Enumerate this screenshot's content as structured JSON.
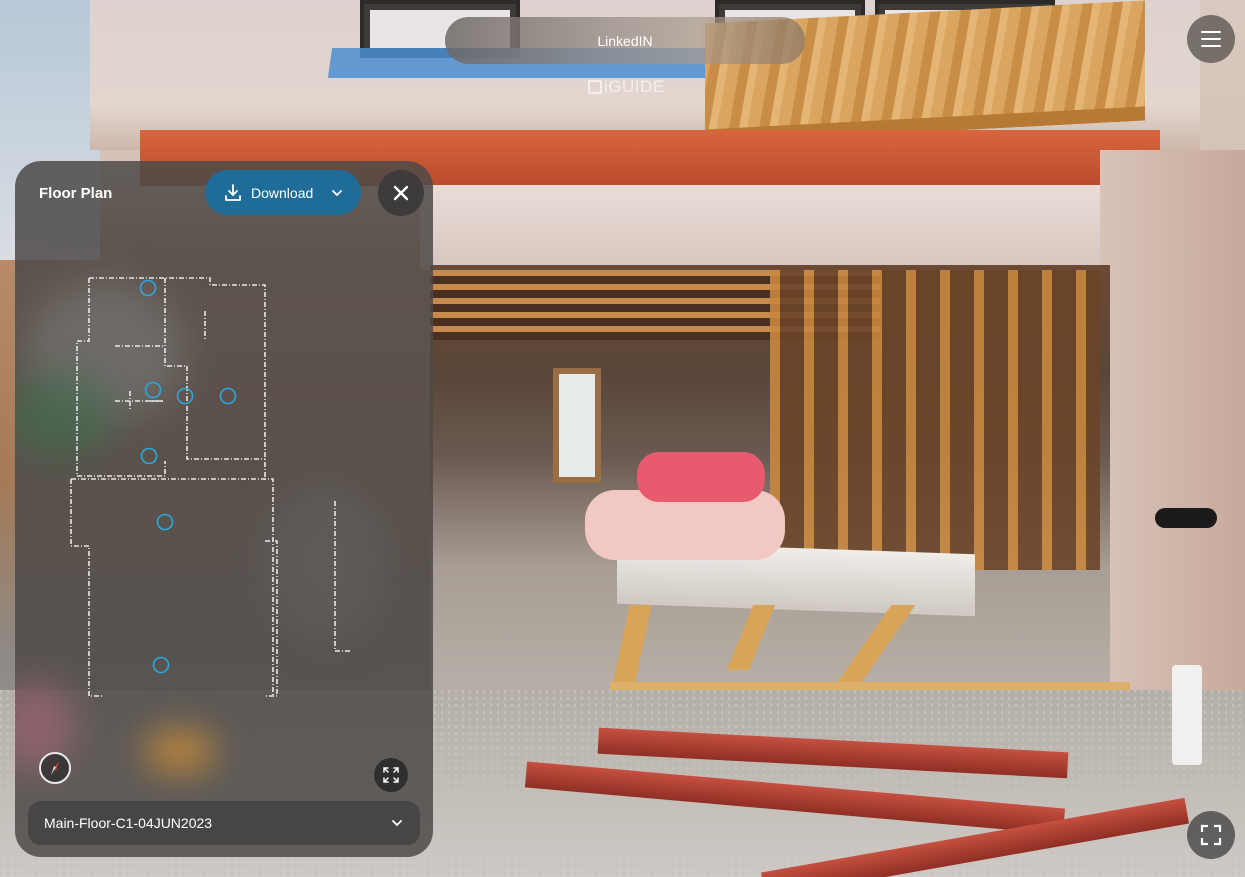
{
  "header": {
    "title": "LinkedIN",
    "brand": "iGUIDE"
  },
  "floor_plan_panel": {
    "title": "Floor Plan",
    "download_label": "Download",
    "selected_floor": "Main-Floor-C1-04JUN2023"
  },
  "colors": {
    "accent": "#1f6c98",
    "marker": "#2aa8e0",
    "panel": "#4e4a48"
  },
  "icons": {
    "menu": "hamburger-icon",
    "close": "close-icon",
    "download": "download-icon",
    "compass": "compass-icon",
    "expand": "expand-icon",
    "fullscreen": "fullscreen-icon",
    "chevron": "chevron-down-icon"
  }
}
